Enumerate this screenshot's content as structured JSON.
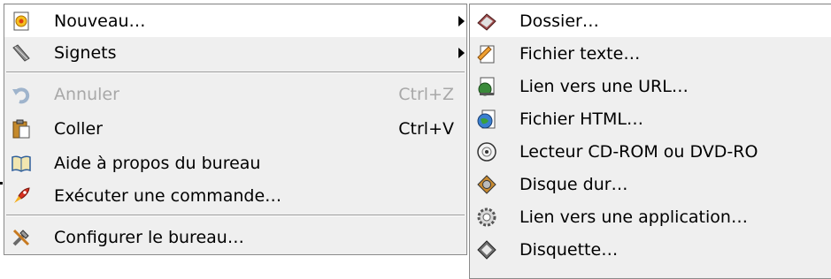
{
  "main_menu": {
    "items": [
      {
        "label": "Nouveau…",
        "icon": "new-icon",
        "submenu": true
      },
      {
        "label": "Signets",
        "icon": "bookmark-icon",
        "submenu": true
      },
      {
        "label": "Annuler",
        "icon": "undo-icon",
        "shortcut": "Ctrl+Z",
        "disabled": true
      },
      {
        "label": "Coller",
        "icon": "paste-icon",
        "shortcut": "Ctrl+V"
      },
      {
        "label": "Aide à propos du bureau",
        "icon": "help-book-icon"
      },
      {
        "label": "Exécuter une commande…",
        "icon": "rocket-icon"
      },
      {
        "label": "Configurer le bureau…",
        "icon": "tools-icon"
      }
    ]
  },
  "sub_menu": {
    "items": [
      {
        "label": "Dossier…",
        "icon": "folder-icon"
      },
      {
        "label": "Fichier texte…",
        "icon": "text-file-icon"
      },
      {
        "label": "Lien vers une URL…",
        "icon": "url-link-icon"
      },
      {
        "label": "Fichier HTML…",
        "icon": "html-file-icon"
      },
      {
        "label": "Lecteur CD-ROM ou DVD-RO",
        "icon": "cdrom-icon"
      },
      {
        "label": "Disque dur…",
        "icon": "harddisk-icon"
      },
      {
        "label": "Lien vers une application…",
        "icon": "app-link-icon"
      },
      {
        "label": "Disquette…",
        "icon": "floppy-icon"
      }
    ]
  },
  "colors": {
    "menu_bg": "#efefef",
    "highlight_bg": "#ffffff",
    "disabled_text": "#a8a8a8"
  }
}
